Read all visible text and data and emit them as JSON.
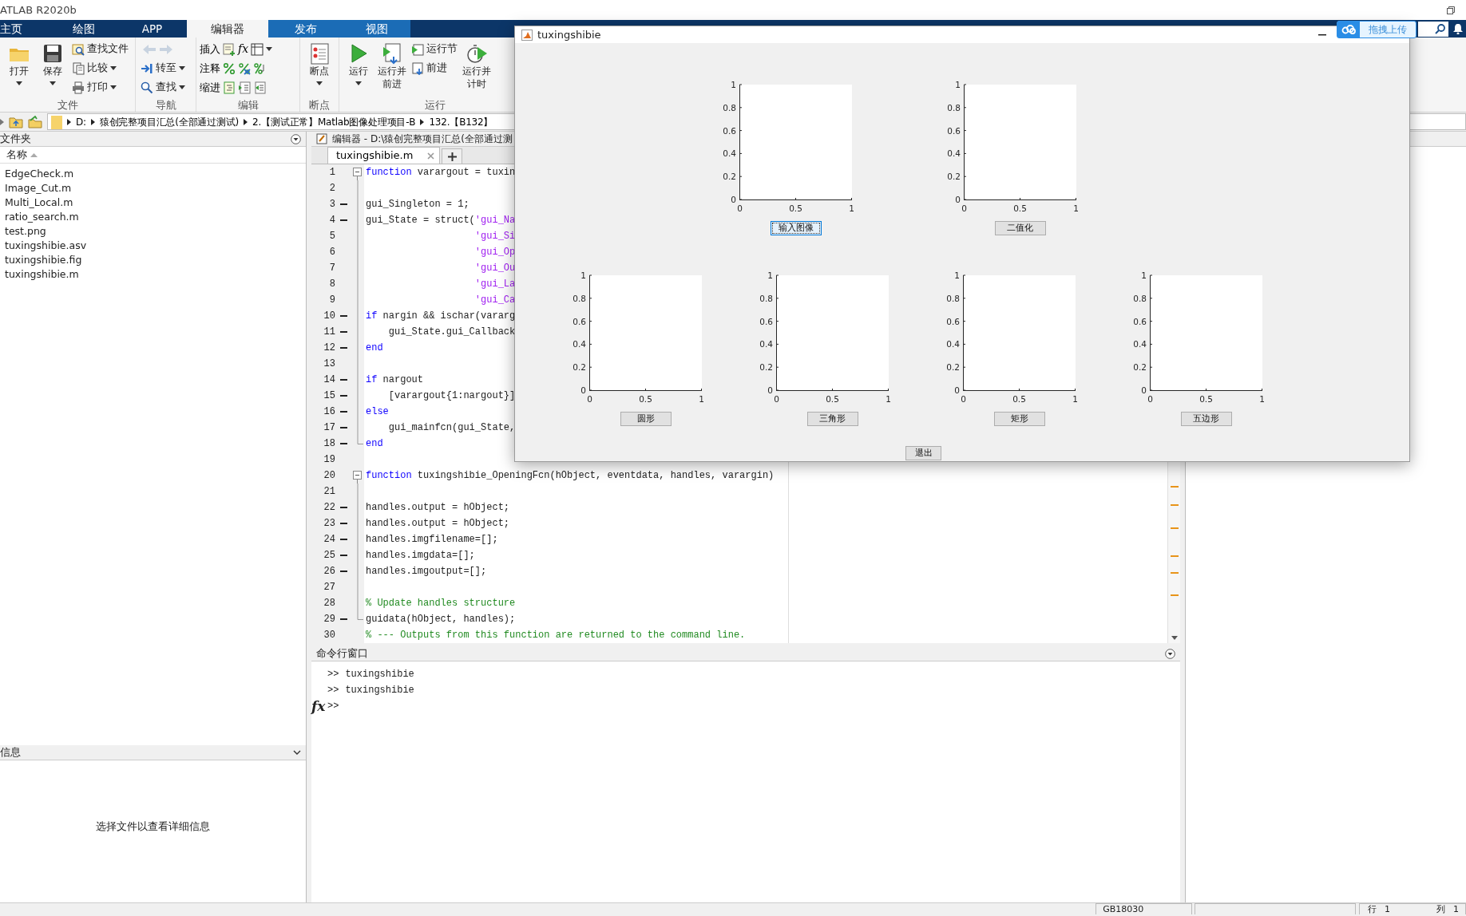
{
  "app_title": "ATLAB R2020b",
  "ribbon_tabs": [
    {
      "label": "主页",
      "kind": "main",
      "selected": false
    },
    {
      "label": "绘图",
      "kind": "main",
      "selected": false
    },
    {
      "label": "APP",
      "kind": "main",
      "selected": false
    },
    {
      "label": "编辑器",
      "kind": "contextual",
      "selected": true
    },
    {
      "label": "发布",
      "kind": "contextual",
      "selected": false
    },
    {
      "label": "视图",
      "kind": "contextual",
      "selected": false
    }
  ],
  "ribbon_groups": [
    {
      "label": "文件",
      "controls": [
        {
          "kind": "large",
          "label": "打开",
          "dropdown": true
        },
        {
          "kind": "large",
          "label": "保存",
          "dropdown": true
        },
        {
          "kind": "small",
          "label": "查找文件",
          "dropdown": false
        },
        {
          "kind": "small",
          "label": "比较",
          "dropdown": true
        },
        {
          "kind": "small",
          "label": "打印",
          "dropdown": true
        }
      ]
    },
    {
      "label": "导航",
      "controls": [
        {
          "kind": "arrows",
          "disabled": true
        },
        {
          "kind": "small",
          "label": "转至",
          "dropdown": true
        },
        {
          "kind": "small",
          "label": "查找",
          "dropdown": true
        }
      ]
    },
    {
      "label": "编辑",
      "controls": [
        {
          "kind": "icon_row",
          "label": "插入",
          "symbol": "fx",
          "dropdown": true
        },
        {
          "kind": "icon_row",
          "label": "注释",
          "dropdown": false
        },
        {
          "kind": "icon_row",
          "label": "缩进",
          "dropdown": false
        }
      ]
    },
    {
      "label": "断点",
      "controls": [
        {
          "kind": "large",
          "label": "断点",
          "dropdown": true
        }
      ]
    },
    {
      "label": "运行",
      "controls": [
        {
          "kind": "large",
          "label": "运行",
          "dropdown": true
        },
        {
          "kind": "large",
          "label": "运行并前进",
          "dropdown": false
        },
        {
          "kind": "small",
          "label": "运行节",
          "dropdown": false
        },
        {
          "kind": "small",
          "label": "前进",
          "dropdown": false
        },
        {
          "kind": "large",
          "label": "运行并计时",
          "dropdown": false
        }
      ]
    }
  ],
  "path": [
    "D:",
    "猿创完整项目汇总(全部通过测试)",
    "2.【测试正常】Matlab图像处理项目-B",
    "132.【B132】"
  ],
  "folder_panel": {
    "title": "文件夹",
    "column": "名称",
    "files": [
      "EdgeCheck.m",
      "Image_Cut.m",
      "Multi_Local.m",
      "ratio_search.m",
      "test.png",
      "tuxingshibie.asv",
      "tuxingshibie.fig",
      "tuxingshibie.m"
    ]
  },
  "details_panel": {
    "title": "信息",
    "message": "选择文件以查看详细信息"
  },
  "editor": {
    "title": "编辑器 - D:\\猿创完整项目汇总(全部通过测",
    "tabs": [
      {
        "label": "tuxingshibie.m",
        "selected": true
      }
    ],
    "lines": [
      {
        "number": "1",
        "executable": false,
        "kind": "fold_start",
        "tokens": [
          {
            "kind": "keyword",
            "text": "function"
          },
          {
            "kind": "plain",
            "text": " varargout = tuxin"
          }
        ]
      },
      {
        "number": "2",
        "executable": false,
        "kind": "fold_inner"
      },
      {
        "number": "3",
        "executable": true,
        "kind": "fold_inner",
        "tokens": [
          {
            "kind": "plain",
            "text": "gui_Singleton = 1;"
          }
        ]
      },
      {
        "number": "4",
        "executable": true,
        "kind": "fold_inner",
        "tokens": [
          {
            "kind": "plain",
            "text": "gui_State = struct("
          },
          {
            "kind": "string",
            "text": "'gui_Na"
          }
        ]
      },
      {
        "number": "5",
        "executable": false,
        "kind": "fold_inner",
        "tokens": [
          {
            "kind": "string",
            "text": "                   'gui_Si"
          }
        ]
      },
      {
        "number": "6",
        "executable": false,
        "kind": "fold_inner",
        "tokens": [
          {
            "kind": "string",
            "text": "                   'gui_Op"
          }
        ]
      },
      {
        "number": "7",
        "executable": false,
        "kind": "fold_inner",
        "tokens": [
          {
            "kind": "string",
            "text": "                   'gui_Ou"
          }
        ]
      },
      {
        "number": "8",
        "executable": false,
        "kind": "fold_inner",
        "tokens": [
          {
            "kind": "string",
            "text": "                   'gui_La"
          }
        ]
      },
      {
        "number": "9",
        "executable": false,
        "kind": "fold_inner",
        "tokens": [
          {
            "kind": "string",
            "text": "                   'gui_Ca"
          }
        ]
      },
      {
        "number": "10",
        "executable": true,
        "kind": "fold_inner",
        "tokens": [
          {
            "kind": "keyword",
            "text": "if"
          },
          {
            "kind": "plain",
            "text": " nargin && ischar(vararg"
          }
        ]
      },
      {
        "number": "11",
        "executable": true,
        "kind": "fold_inner",
        "tokens": [
          {
            "kind": "plain",
            "text": "    gui_State.gui_Callback"
          }
        ]
      },
      {
        "number": "12",
        "executable": true,
        "kind": "fold_inner",
        "tokens": [
          {
            "kind": "keyword",
            "text": "end"
          }
        ]
      },
      {
        "number": "13",
        "executable": false,
        "kind": "fold_inner"
      },
      {
        "number": "14",
        "executable": true,
        "kind": "fold_inner",
        "tokens": [
          {
            "kind": "keyword",
            "text": "if"
          },
          {
            "kind": "plain",
            "text": " nargout"
          }
        ]
      },
      {
        "number": "15",
        "executable": true,
        "kind": "fold_inner",
        "tokens": [
          {
            "kind": "plain",
            "text": "    [varargout{1:nargout}]"
          }
        ]
      },
      {
        "number": "16",
        "executable": true,
        "kind": "fold_inner",
        "tokens": [
          {
            "kind": "keyword",
            "text": "else"
          }
        ]
      },
      {
        "number": "17",
        "executable": true,
        "kind": "fold_inner",
        "tokens": [
          {
            "kind": "plain",
            "text": "    gui_mainfcn(gui_State,"
          }
        ]
      },
      {
        "number": "18",
        "executable": true,
        "kind": "fold_end",
        "tokens": [
          {
            "kind": "keyword",
            "text": "end"
          }
        ]
      },
      {
        "number": "19",
        "executable": false,
        "kind": "plain"
      },
      {
        "number": "20",
        "executable": false,
        "kind": "fold_start",
        "tokens": [
          {
            "kind": "keyword",
            "text": "function"
          },
          {
            "kind": "plain",
            "text": " tuxingshibie_OpeningFcn(hObject, eventdata, handles, varargin)"
          }
        ]
      },
      {
        "number": "21",
        "executable": false,
        "kind": "fold_inner"
      },
      {
        "number": "22",
        "executable": true,
        "kind": "fold_inner",
        "tokens": [
          {
            "kind": "plain",
            "text": "handles.output = hObject;"
          }
        ]
      },
      {
        "number": "23",
        "executable": true,
        "kind": "fold_inner",
        "tokens": [
          {
            "kind": "plain",
            "text": "handles.output = hObject;"
          }
        ]
      },
      {
        "number": "24",
        "executable": true,
        "kind": "fold_inner",
        "tokens": [
          {
            "kind": "plain",
            "text": "handles.imgfilename=[];"
          }
        ]
      },
      {
        "number": "25",
        "executable": true,
        "kind": "fold_inner",
        "tokens": [
          {
            "kind": "plain",
            "text": "handles.imgdata=[];"
          }
        ]
      },
      {
        "number": "26",
        "executable": true,
        "kind": "fold_inner",
        "tokens": [
          {
            "kind": "plain",
            "text": "handles.imgoutput=[];"
          }
        ]
      },
      {
        "number": "27",
        "executable": false,
        "kind": "fold_inner"
      },
      {
        "number": "28",
        "executable": false,
        "kind": "fold_inner",
        "tokens": [
          {
            "kind": "comment",
            "text": "% Update handles structure"
          }
        ]
      },
      {
        "number": "29",
        "executable": true,
        "kind": "fold_end",
        "tokens": [
          {
            "kind": "plain",
            "text": "guidata(hObject, handles);"
          }
        ]
      },
      {
        "number": "30",
        "executable": false,
        "kind": "plain",
        "tokens": [
          {
            "kind": "comment",
            "text": "% --- Outputs from this function are returned to the command line."
          }
        ]
      }
    ]
  },
  "command_window": {
    "title": "命令行窗口",
    "symbol": "fx",
    "lines": [
      {
        "prompt": ">>",
        "text": "tuxingshibie"
      },
      {
        "prompt": ">>",
        "text": "tuxingshibie"
      },
      {
        "prompt": ">>"
      }
    ]
  },
  "status_bar": {
    "encoding": "GB18030",
    "row_label": "行",
    "row": "1",
    "col_label": "列",
    "col": "1"
  },
  "upload_button": {
    "label": "拖拽上传"
  },
  "figure_window": {
    "title": "tuxingshibie",
    "top_panels": [
      {
        "y_ticks": [
          "1",
          "0.8",
          "0.6",
          "0.4",
          "0.2",
          "0"
        ],
        "x_ticks": [
          "0",
          "0.5",
          "1"
        ],
        "button": {
          "label": "输入图像",
          "focused": true
        }
      },
      {
        "y_ticks": [
          "1",
          "0.8",
          "0.6",
          "0.4",
          "0.2",
          "0"
        ],
        "x_ticks": [
          "0",
          "0.5",
          "1"
        ],
        "button": {
          "label": "二值化",
          "focused": false
        }
      }
    ],
    "bottom_panels": [
      {
        "y_ticks": [
          "1",
          "0.8",
          "0.6",
          "0.4",
          "0.2",
          "0"
        ],
        "x_ticks": [
          "0",
          "0.5",
          "1"
        ],
        "button": {
          "label": "圆形",
          "focused": false
        }
      },
      {
        "y_ticks": [
          "1",
          "0.8",
          "0.6",
          "0.4",
          "0.2",
          "0"
        ],
        "x_ticks": [
          "0",
          "0.5",
          "1"
        ],
        "button": {
          "label": "三角形",
          "focused": false
        }
      },
      {
        "y_ticks": [
          "1",
          "0.8",
          "0.6",
          "0.4",
          "0.2",
          "0"
        ],
        "x_ticks": [
          "0",
          "0.5",
          "1"
        ],
        "button": {
          "label": "矩形",
          "focused": false
        }
      },
      {
        "y_ticks": [
          "1",
          "0.8",
          "0.6",
          "0.4",
          "0.2",
          "0"
        ],
        "x_ticks": [
          "0",
          "0.5",
          "1"
        ],
        "button": {
          "label": "五边形",
          "focused": false
        }
      }
    ],
    "exit_button": {
      "label": "退出",
      "focused": false
    }
  }
}
